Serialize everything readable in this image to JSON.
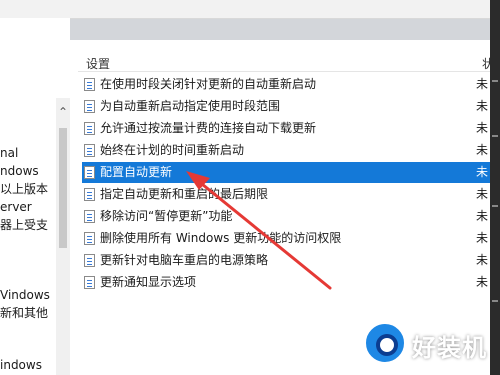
{
  "left_panel": {
    "lines": [
      "nal",
      "ndows",
      "以上版本",
      "erver",
      "器上受支",
      "Vindows",
      "新和其他",
      "indows"
    ]
  },
  "list": {
    "header_setting": "设置",
    "header_state": "状",
    "rows": [
      {
        "label": "在使用时段关闭针对更新的自动重新启动",
        "state": "未"
      },
      {
        "label": "为自动重新启动指定使用时段范围",
        "state": "未"
      },
      {
        "label": "允许通过按流量计费的连接自动下载更新",
        "state": "未"
      },
      {
        "label": "始终在计划的时间重新启动",
        "state": "未"
      },
      {
        "label": "配置自动更新",
        "state": "未",
        "selected": true
      },
      {
        "label": "指定自动更新和重启的最后期限",
        "state": "未"
      },
      {
        "label": "移除访问“暂停更新”功能",
        "state": "未"
      },
      {
        "label": "删除使用所有 Windows 更新功能的访问权限",
        "state": "未"
      },
      {
        "label": "更新针对电脑车重启的电源策略",
        "state": "未"
      },
      {
        "label": "更新通知显示选项",
        "state": "未"
      }
    ]
  },
  "watermark": {
    "text": "好装机"
  },
  "colors": {
    "selection": "#1479d8",
    "annotation_arrow": "#e53935"
  }
}
